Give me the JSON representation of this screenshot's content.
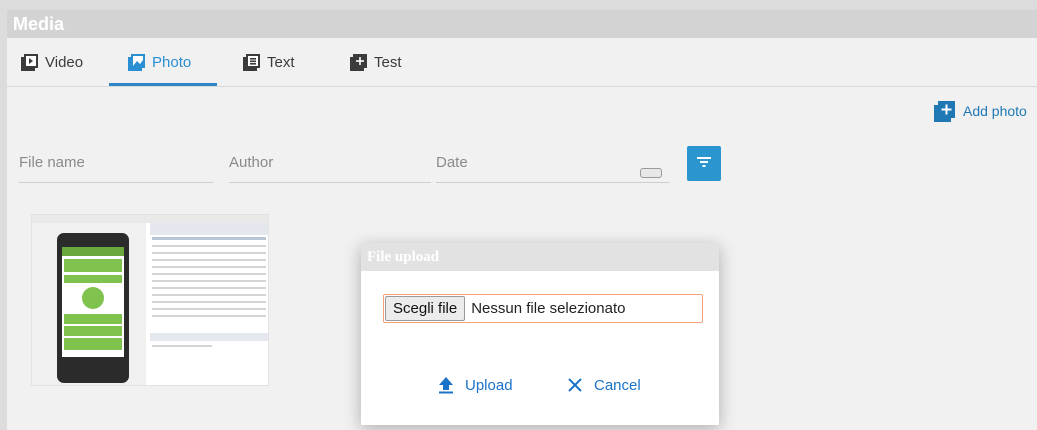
{
  "app": {
    "title": "Media"
  },
  "tabs": [
    {
      "label": "Video",
      "icon": "video-icon",
      "active": false
    },
    {
      "label": "Photo",
      "icon": "photo-icon",
      "active": true
    },
    {
      "label": "Text",
      "icon": "text-icon",
      "active": false
    },
    {
      "label": "Test",
      "icon": "test-icon",
      "active": false
    }
  ],
  "toolbar": {
    "add_photo_label": "Add photo",
    "add_icon": "add-box-icon"
  },
  "filters": {
    "file_name_placeholder": "File name",
    "author_placeholder": "Author",
    "date_placeholder": "Date",
    "filter_icon": "filter-icon"
  },
  "thumbnail": {
    "image": "screenshot-thumbnail"
  },
  "dialog": {
    "title": "File upload",
    "choose_file_label": "Scegli file",
    "no_file_label": "Nessun file selezionato",
    "upload_label": "Upload",
    "cancel_label": "Cancel",
    "upload_icon": "upload-icon",
    "cancel_icon": "close-icon"
  },
  "colors": {
    "accent": "#2b8fd4",
    "button_blue": "#2a95cf",
    "dialog_border": "#f1a27c"
  }
}
